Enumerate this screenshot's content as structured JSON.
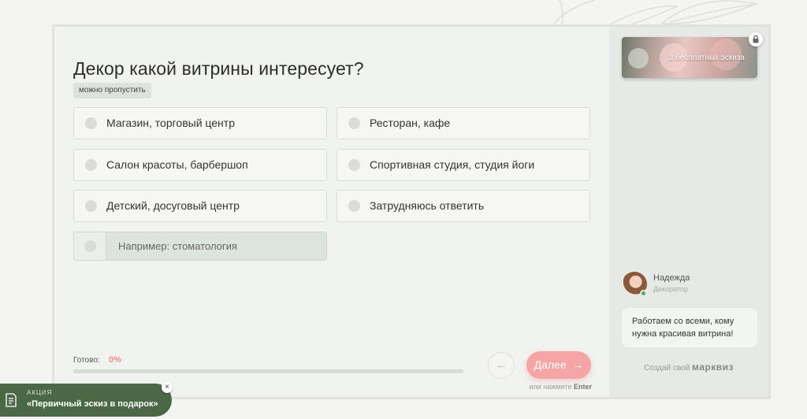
{
  "quiz": {
    "question": "Декор какой витрины интересует?",
    "skip_label": "можно пропустить",
    "options": [
      {
        "label": "Магазин, торговый центр"
      },
      {
        "label": "Ресторан, кафе"
      },
      {
        "label": "Салон красоты, барбершоп"
      },
      {
        "label": "Спортивная студия, студия йоги"
      },
      {
        "label": "Детский, досуговый центр"
      },
      {
        "label": "Затрудняюсь ответить"
      }
    ],
    "other_placeholder": "Например: стоматология"
  },
  "progress": {
    "label": "Готово:",
    "value_text": "0%",
    "fraction": 0,
    "color": "#ef8a8a"
  },
  "nav": {
    "back_icon": "arrow-left-icon",
    "next_label": "Далее",
    "next_icon": "arrow-right-icon",
    "enter_hint_prefix": "или нажмите",
    "enter_hint_key": "Enter"
  },
  "sidebar": {
    "promo_text": "3 бесплатных эскиза",
    "lock_icon": "lock-icon",
    "agent": {
      "name": "Надежда",
      "role": "Декоратор",
      "message": "Работаем со всеми, кому нужна красивая витрина!"
    },
    "footer_prefix": "Создай свой",
    "footer_brand": "марквиз"
  },
  "banner": {
    "tag": "АКЦИЯ",
    "title": "«Первичный эскиз в подарок»",
    "close_label": "×",
    "color": "#4a6845"
  },
  "colors": {
    "accent": "#ef8a8a",
    "next_button": "#f5a5a5",
    "sidebar_bg": "#e6e9e5",
    "online": "#4caf50"
  }
}
